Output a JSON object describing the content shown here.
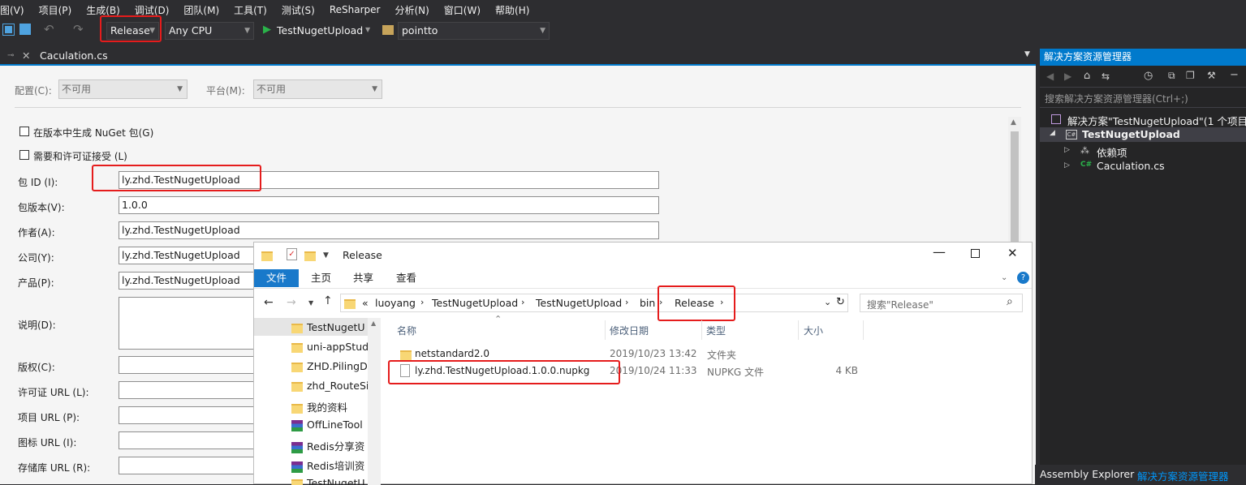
{
  "menu": {
    "items": [
      "图(V)",
      "项目(P)",
      "生成(B)",
      "调试(D)",
      "团队(M)",
      "工具(T)",
      "测试(S)",
      "ReSharper",
      "分析(N)",
      "窗口(W)",
      "帮助(H)"
    ]
  },
  "toolbar": {
    "config": "Release",
    "platform": "Any CPU",
    "start_project": "TestNugetUpload",
    "project_combo": "pointto"
  },
  "doc_tab": {
    "filename": "Caculation.cs"
  },
  "editor": {
    "config_label": "配置(C):",
    "config_value": "不可用",
    "platform_label": "平台(M):",
    "platform_value": "不可用",
    "gen_nuget_label": "在版本中生成 NuGet 包(G)",
    "license_accept_label": "需要和许可证接受 (L)",
    "fields": [
      {
        "label": "包 ID (I):",
        "value": "ly.zhd.TestNugetUpload"
      },
      {
        "label": "包版本(V):",
        "value": "1.0.0"
      },
      {
        "label": "作者(A):",
        "value": "ly.zhd.TestNugetUpload"
      },
      {
        "label": "公司(Y):",
        "value": "ly.zhd.TestNugetUpload"
      },
      {
        "label": "产品(P):",
        "value": "ly.zhd.TestNugetUpload"
      },
      {
        "label": "说明(D):",
        "value": ""
      },
      {
        "label": "版权(C):",
        "value": ""
      },
      {
        "label": "许可证 URL (L):",
        "value": ""
      },
      {
        "label": "项目 URL (P):",
        "value": ""
      },
      {
        "label": "图标 URL (I):",
        "value": ""
      },
      {
        "label": "存储库 URL (R):",
        "value": ""
      }
    ]
  },
  "solution_explorer": {
    "title": "解决方案资源管理器",
    "search_placeholder": "搜索解决方案资源管理器(Ctrl+;)",
    "solution": "解决方案\"TestNugetUpload\"(1 个项目)",
    "project": "TestNugetUpload",
    "deps": "依赖项",
    "file": "Caculation.cs",
    "bottom_tabs": [
      "Assembly Explorer",
      "解决方案资源管理器"
    ]
  },
  "explorer": {
    "title": "Release",
    "ribbon_tabs": [
      "文件",
      "主页",
      "共享",
      "查看"
    ],
    "breadcrumb": [
      "«",
      "luoyang",
      "TestNugetUpload",
      "TestNugetUpload",
      "bin",
      "Release"
    ],
    "search_placeholder": "搜索\"Release\"",
    "nav_items": [
      {
        "name": "TestNugetU",
        "icon": "folder"
      },
      {
        "name": "uni-appStud",
        "icon": "folder"
      },
      {
        "name": "ZHD.PilingDr",
        "icon": "folder"
      },
      {
        "name": "zhd_RouteSi",
        "icon": "folder"
      },
      {
        "name": "我的资料",
        "icon": "folder"
      },
      {
        "name": "OffLineTool",
        "icon": "winrar"
      },
      {
        "name": "Redis分享资",
        "icon": "winrar"
      },
      {
        "name": "Redis培训资",
        "icon": "winrar"
      },
      {
        "name": "TestNugetU",
        "icon": "folder"
      }
    ],
    "columns": [
      "名称",
      "修改日期",
      "类型",
      "大小"
    ],
    "files": [
      {
        "name": "netstandard2.0",
        "date": "2019/10/23 13:42",
        "type": "文件夹",
        "size": "",
        "icon": "folder"
      },
      {
        "name": "ly.zhd.TestNugetUpload.1.0.0.nupkg",
        "date": "2019/10/24 11:33",
        "type": "NUPKG 文件",
        "size": "4 KB",
        "icon": "file"
      }
    ]
  },
  "colors": {
    "accent": "#007acc",
    "highlight_box": "#e51c1c",
    "vs_dark": "#2d2d30"
  }
}
